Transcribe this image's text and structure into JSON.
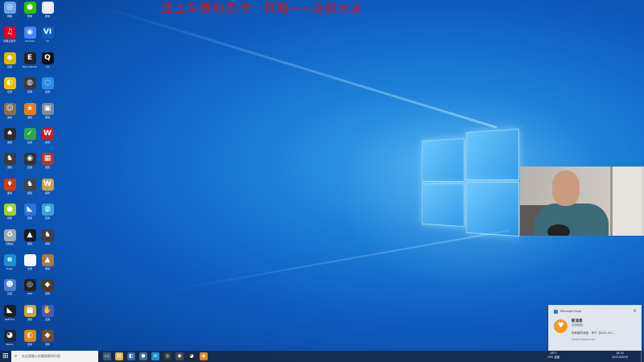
{
  "banner": {
    "text": "送上车卷和办卡一样哦~~感谢大家",
    "color": "#d4141b"
  },
  "desktop_icons": [
    {
      "name": "network-icon",
      "glyph": "◎",
      "color": "#6aa6e8",
      "label": "网络"
    },
    {
      "name": "wechat-icon",
      "glyph": "●",
      "color": "#2dc100",
      "label": "微信"
    },
    {
      "name": "file-icon",
      "glyph": "▤",
      "color": "#e8e8e8",
      "label": "新建"
    },
    {
      "name": "netease-music-icon",
      "glyph": "♫",
      "color": "#e60026",
      "label": "网易云音乐"
    },
    {
      "name": "chrome-icon",
      "glyph": "◉",
      "color": "#4285f4",
      "label": "Chrome"
    },
    {
      "name": "text-vi-icon",
      "glyph": "VI",
      "color": "#0d5ec0",
      "label": "VI"
    },
    {
      "name": "app-yellow-icon",
      "glyph": "◆",
      "color": "#e2b400",
      "label": "应用"
    },
    {
      "name": "epic-games-icon",
      "glyph": "E",
      "color": "#222222",
      "label": "Epic Games"
    },
    {
      "name": "qq-icon",
      "glyph": "Q",
      "color": "#111111",
      "label": "QQ"
    },
    {
      "name": "app-yellow2-icon",
      "glyph": "◐",
      "color": "#f0c000",
      "label": "应用"
    },
    {
      "name": "app-dark-icon",
      "glyph": "◍",
      "color": "#3a3a3a",
      "label": "应用"
    },
    {
      "name": "app-blue-icon",
      "glyph": "◌",
      "color": "#2a8ee6",
      "label": "应用"
    },
    {
      "name": "game-avatar-icon",
      "glyph": "☺",
      "color": "#8a6e4b",
      "label": "游戏"
    },
    {
      "name": "game-orange-icon",
      "glyph": "★",
      "color": "#e77b1c",
      "label": "游戏"
    },
    {
      "name": "game-gray-icon",
      "glyph": "▣",
      "color": "#7a8a99",
      "label": "游戏"
    },
    {
      "name": "game-hat-icon",
      "glyph": "♠",
      "color": "#2b2b2b",
      "label": "游戏"
    },
    {
      "name": "check-green-icon",
      "glyph": "✓",
      "color": "#2ea84a",
      "label": "应用"
    },
    {
      "name": "game-red-w-icon",
      "glyph": "W",
      "color": "#c81e28",
      "label": "游戏"
    },
    {
      "name": "game-knight-icon",
      "glyph": "♞",
      "color": "#3b3b3b",
      "label": "游戏"
    },
    {
      "name": "app-round-icon",
      "glyph": "◉",
      "color": "#333333",
      "label": "应用"
    },
    {
      "name": "game-red-icon",
      "glyph": "▦",
      "color": "#b33a2a",
      "label": "游戏"
    },
    {
      "name": "game-fire-icon",
      "glyph": "♦",
      "color": "#d13b14",
      "label": "游戏"
    },
    {
      "name": "game-knight2-icon",
      "glyph": "♞",
      "color": "#444444",
      "label": "游戏"
    },
    {
      "name": "game-w-icon",
      "glyph": "W",
      "color": "#c9a04a",
      "label": "游戏"
    },
    {
      "name": "app-lemon-icon",
      "glyph": "●",
      "color": "#9bd42e",
      "label": "应用"
    },
    {
      "name": "app-blue-bird-icon",
      "glyph": "◣",
      "color": "#2a72d8",
      "label": "应用"
    },
    {
      "name": "app-globe-icon",
      "glyph": "◍",
      "color": "#36a3e0",
      "label": "应用"
    },
    {
      "name": "recycle-bin-icon",
      "glyph": "♻",
      "color": "#9aa7b4",
      "label": "回收站"
    },
    {
      "name": "game-black-icon",
      "glyph": "▲",
      "color": "#1a1a1a",
      "label": "游戏"
    },
    {
      "name": "game-knight3-icon",
      "glyph": "♞",
      "color": "#3f3f3f",
      "label": "游戏"
    },
    {
      "name": "edge-icon",
      "glyph": "e",
      "color": "#1d8fd6",
      "label": "Edge"
    },
    {
      "name": "document-icon",
      "glyph": "▤",
      "color": "#f4f4f4",
      "label": "文档"
    },
    {
      "name": "game-landscape-icon",
      "glyph": "▲",
      "color": "#a57a48",
      "label": "游戏"
    },
    {
      "name": "app-people-icon",
      "glyph": "☻",
      "color": "#4a7fd0",
      "label": "应用"
    },
    {
      "name": "obs-icon",
      "glyph": "◎",
      "color": "#222222",
      "label": "OBS"
    },
    {
      "name": "game-dark-icon",
      "glyph": "◆",
      "color": "#4a3a2a",
      "label": "游戏"
    },
    {
      "name": "nvidia-icon",
      "glyph": "◣",
      "color": "#1f1f1f",
      "label": "GeForce"
    },
    {
      "name": "game-yellow-icon",
      "glyph": "■",
      "color": "#c9a23a",
      "label": "游戏"
    },
    {
      "name": "app-hand-icon",
      "glyph": "✋",
      "color": "#4c5bb5",
      "label": "应用"
    },
    {
      "name": "steam-icon",
      "glyph": "◕",
      "color": "#1b2838",
      "label": "Steam"
    },
    {
      "name": "app-orange-icon",
      "glyph": "◐",
      "color": "#e0861a",
      "label": "应用"
    },
    {
      "name": "game-brown-icon",
      "glyph": "◆",
      "color": "#7a4a2a",
      "label": "游戏"
    }
  ],
  "notification": {
    "app": "Microsoft Edge",
    "title": "新消息",
    "subtitle": "来自网站",
    "body": "你有新的消息，来于【2021-09-...",
    "url": "edge://www.com",
    "close": "×",
    "avatar": "♥"
  },
  "taskbar": {
    "start_glyph": "⊞",
    "search_placeholder": "在这里输入你要搜索的内容",
    "apps": [
      {
        "name": "task-view-icon",
        "glyph": "▭",
        "color": "#3a5a80"
      },
      {
        "name": "file-explorer-icon",
        "glyph": "▤",
        "color": "#e0b23c"
      },
      {
        "name": "store-icon",
        "glyph": "◧",
        "color": "#2d6bb0"
      },
      {
        "name": "app-taskbar-icon",
        "glyph": "●",
        "color": "#4a6a90"
      },
      {
        "name": "edge-taskbar-icon",
        "glyph": "e",
        "color": "#1d8fd6"
      },
      {
        "name": "obs-taskbar-icon",
        "glyph": "◎",
        "color": "#333333"
      },
      {
        "name": "app2-taskbar-icon",
        "glyph": "◉",
        "color": "#4a4a4a"
      },
      {
        "name": "steam-taskbar-icon",
        "glyph": "◕",
        "color": "#1b2838"
      },
      {
        "name": "app3-taskbar-icon",
        "glyph": "◆",
        "color": "#e0861a"
      }
    ],
    "weather": "28°C",
    "weather_sub": "CPU 温度",
    "time": "18:32",
    "date": "2021/09/19"
  }
}
